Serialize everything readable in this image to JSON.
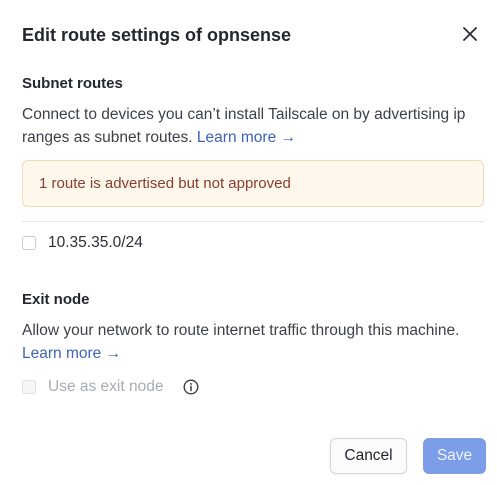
{
  "dialog": {
    "title": "Edit route settings of opnsense",
    "close_icon": "close-icon"
  },
  "subnet": {
    "heading": "Subnet routes",
    "description": "Connect to devices you can’t install Tailscale on by advertising ip ranges as subnet routes.",
    "learn_more": "Learn more →",
    "warning": "1 route is advertised but not approved",
    "routes": [
      {
        "label": "10.35.35.0/24",
        "checked": false
      }
    ]
  },
  "exit_node": {
    "heading": "Exit node",
    "description": "Allow your network to route internet traffic through this machine.",
    "learn_more": "Learn more →",
    "checkbox_label": "Use as exit node",
    "checked": false,
    "disabled": true,
    "info_icon": "info-icon"
  },
  "footer": {
    "cancel_label": "Cancel",
    "save_label": "Save"
  },
  "colors": {
    "link": "#3e63b8",
    "warning_text": "#8b3b2f",
    "warning_bg": "#fef8ec",
    "primary_button": "#7c9de8"
  }
}
